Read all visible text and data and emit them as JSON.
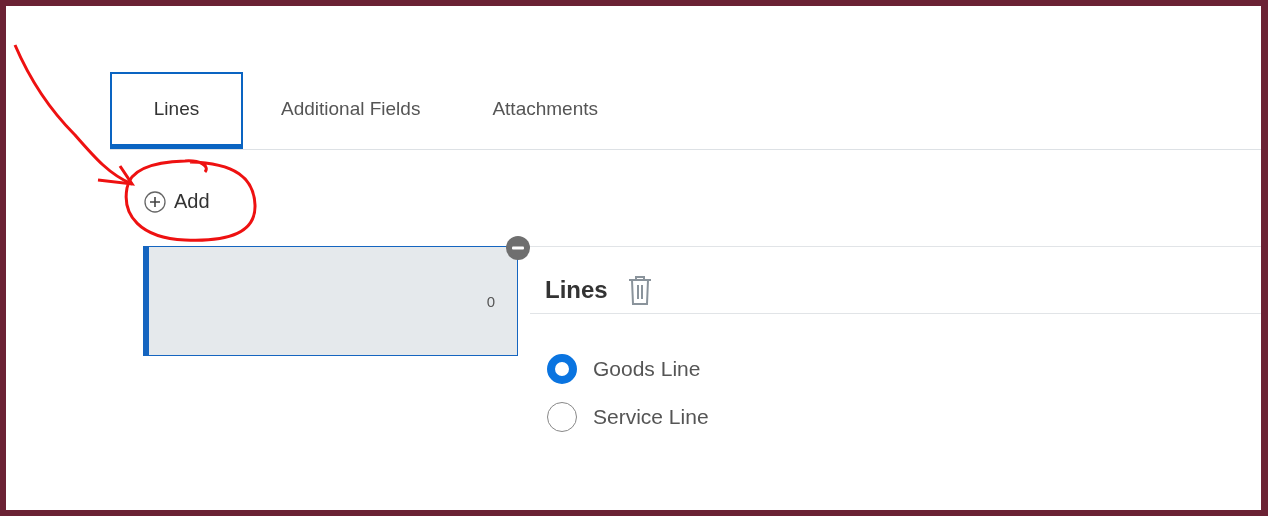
{
  "tabs": [
    {
      "label": "Lines",
      "selected": true
    },
    {
      "label": "Additional Fields",
      "selected": false
    },
    {
      "label": "Attachments",
      "selected": false
    }
  ],
  "add_button": {
    "label": "Add"
  },
  "line_card": {
    "value": "0",
    "selected": true
  },
  "section": {
    "title": "Lines"
  },
  "line_type": [
    {
      "label": "Goods Line",
      "selected": true
    },
    {
      "label": "Service Line",
      "selected": false
    }
  ]
}
